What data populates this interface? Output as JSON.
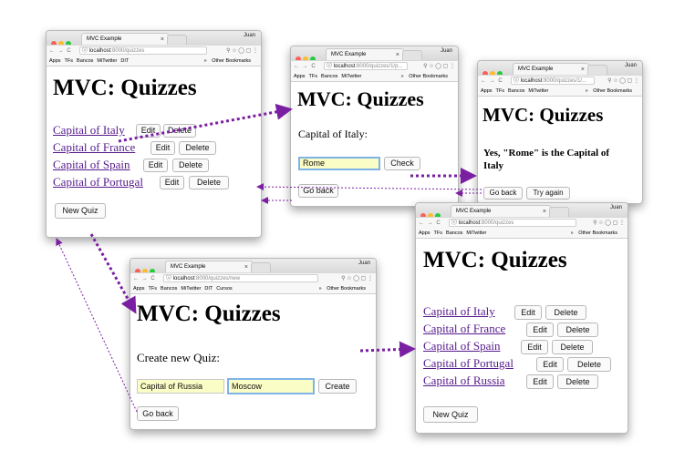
{
  "window": {
    "tab_title": "MVC Example",
    "tab_close": "×",
    "user": "Juan",
    "nav_glyphs": "← → C",
    "info_glyph": "ⓘ",
    "url_host": "localhost",
    "tool_glyphs": "⚲ ☆ ◯ ▢ ⋮"
  },
  "bookmarks": {
    "apps": "Apps",
    "tfs": "TFs",
    "bancos": "Bancos",
    "miwitter": "MiTwitter",
    "dit": "DIT",
    "cursos": "Cursos",
    "more": "»",
    "other": "Other Bookmarks"
  },
  "heading": "MVC: Quizzes",
  "win1": {
    "url_path": ":8000/quizzes",
    "quizzes": [
      "Capital of Italy",
      "Capital of France",
      "Capital of Spain",
      "Capital of Portugal"
    ],
    "edit_label": "Edit",
    "delete_label": "Delete",
    "new_quiz_label": "New Quiz"
  },
  "win2": {
    "url_path": ":8000/quizzes/1/p...",
    "question": "Capital of Italy:",
    "answer_value": "Rome",
    "check_label": "Check",
    "go_back_label": "Go back"
  },
  "win3": {
    "url_path": ":8000/quizzes/1/...",
    "result_line1": "Yes, \"Rome\" is the Capital of",
    "result_line2": "Italy",
    "go_back_label": "Go back",
    "try_again_label": "Try again"
  },
  "win4": {
    "url_path": ":8000/quizzes/new",
    "create_prompt": "Create new Quiz:",
    "question_value": "Capital of Russia",
    "answer_value": "Moscow",
    "create_label": "Create",
    "go_back_label": "Go back"
  },
  "win5": {
    "url_path": ":8000/quizzes",
    "quizzes": [
      "Capital of Italy",
      "Capital of France",
      "Capital of Spain",
      "Capital of Portugal",
      "Capital of Russia"
    ],
    "edit_label": "Edit",
    "delete_label": "Delete",
    "new_quiz_label": "New Quiz"
  },
  "colors": {
    "arrow": "#7b1fa2",
    "link": "#551a8b",
    "input_fill": "#fafdc5",
    "focus_ring": "#7fb3e8"
  }
}
